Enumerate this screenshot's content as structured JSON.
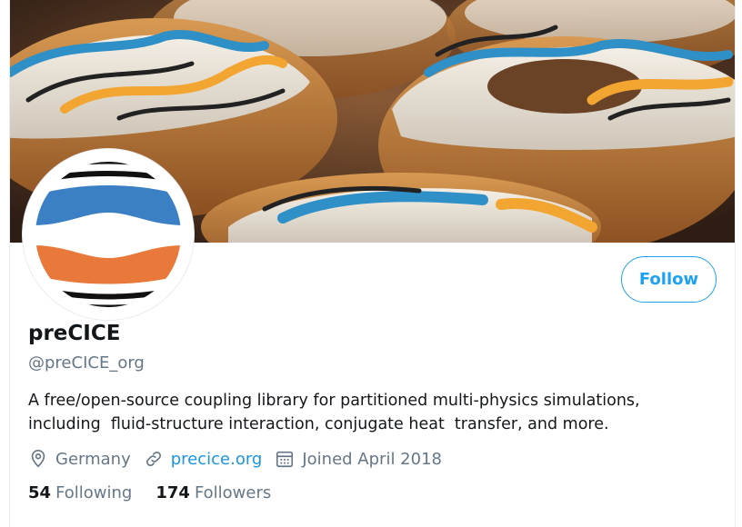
{
  "profile": {
    "name": "preCICE",
    "handle": "@preCICE_org",
    "bio_line1": "A free/open-source coupling library for partitioned multi-physics simulations,",
    "bio_line2": "including  fluid-structure interaction, conjugate heat  transfer, and more.",
    "location": "Germany",
    "website": "precice.org",
    "joined": "Joined April 2018"
  },
  "actions": {
    "follow_label": "Follow"
  },
  "stats": {
    "following_count": "54",
    "following_label": "Following",
    "followers_count": "174",
    "followers_label": "Followers"
  },
  "icons": {
    "location": "location-pin-icon",
    "website": "link-icon",
    "joined": "calendar-icon"
  },
  "colors": {
    "accent": "#1da1f2",
    "link": "#1b95e0",
    "muted": "#657786",
    "logo_blue": "#3b7fc4",
    "logo_orange": "#e8793a"
  }
}
